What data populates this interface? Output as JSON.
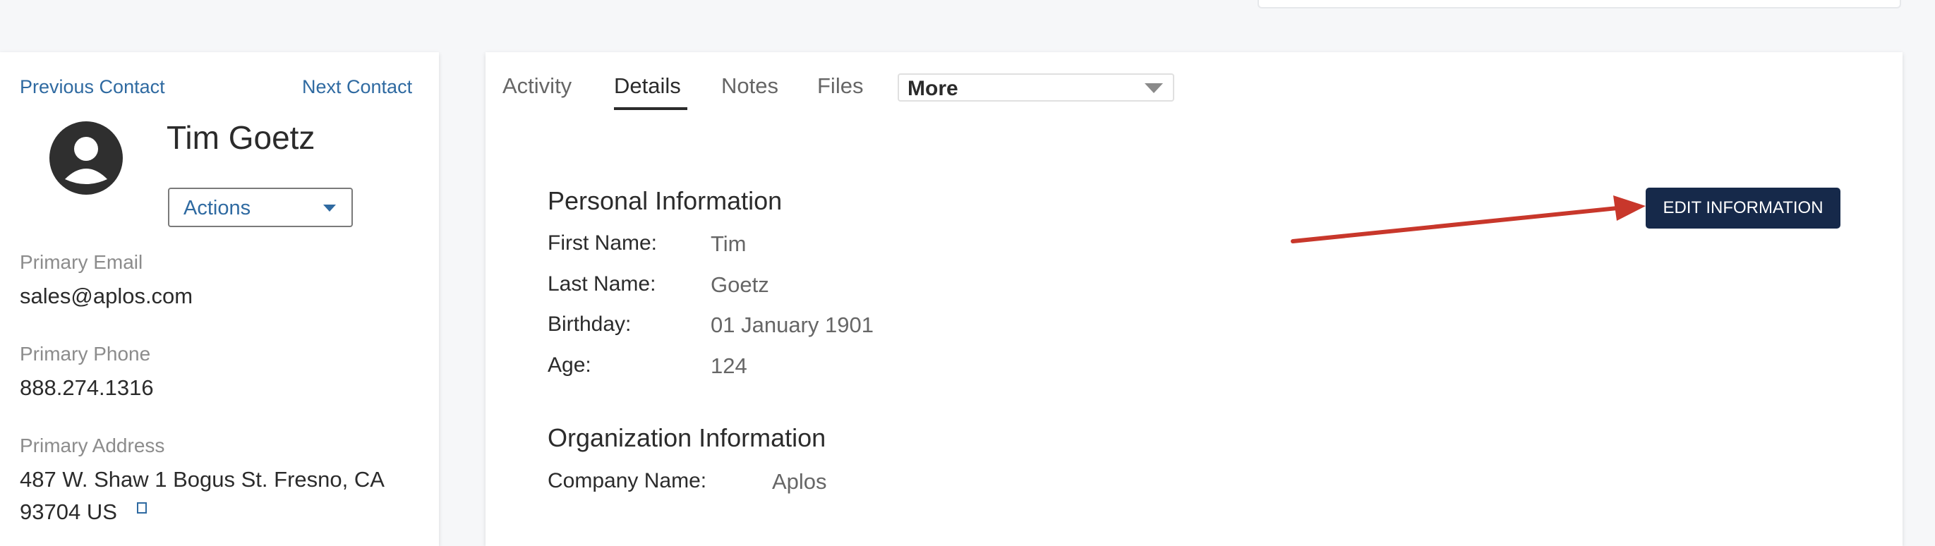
{
  "contact_nav": {
    "previous_label": "Previous Contact",
    "next_label": "Next Contact"
  },
  "contact": {
    "name": "Tim Goetz",
    "actions_label": "Actions",
    "primary_email_label": "Primary Email",
    "primary_email": "sales@aplos.com",
    "primary_phone_label": "Primary Phone",
    "primary_phone": "888.274.1316",
    "primary_address_label": "Primary Address",
    "primary_address_line1": "487 W. Shaw 1 Bogus St. Fresno, CA",
    "primary_address_line2": "93704 US"
  },
  "tabs": {
    "items": [
      {
        "label": "Activity"
      },
      {
        "label": "Details"
      },
      {
        "label": "Notes"
      },
      {
        "label": "Files"
      }
    ],
    "active": "Details",
    "more_label": "More"
  },
  "details": {
    "edit_button_label": "EDIT INFORMATION",
    "personal_section_title": "Personal Information",
    "personal_fields": [
      {
        "label": "First Name:",
        "value": "Tim"
      },
      {
        "label": "Last Name:",
        "value": "Goetz"
      },
      {
        "label": "Birthday:",
        "value": "01 January 1901"
      },
      {
        "label": "Age:",
        "value": "124"
      }
    ],
    "organization_section_title": "Organization Information",
    "organization_fields": [
      {
        "label": "Company Name:",
        "value": "Aplos"
      }
    ]
  },
  "colors": {
    "link": "#2f6aa1",
    "primary_button": "#16294a",
    "annotation_arrow": "#c8372b"
  }
}
